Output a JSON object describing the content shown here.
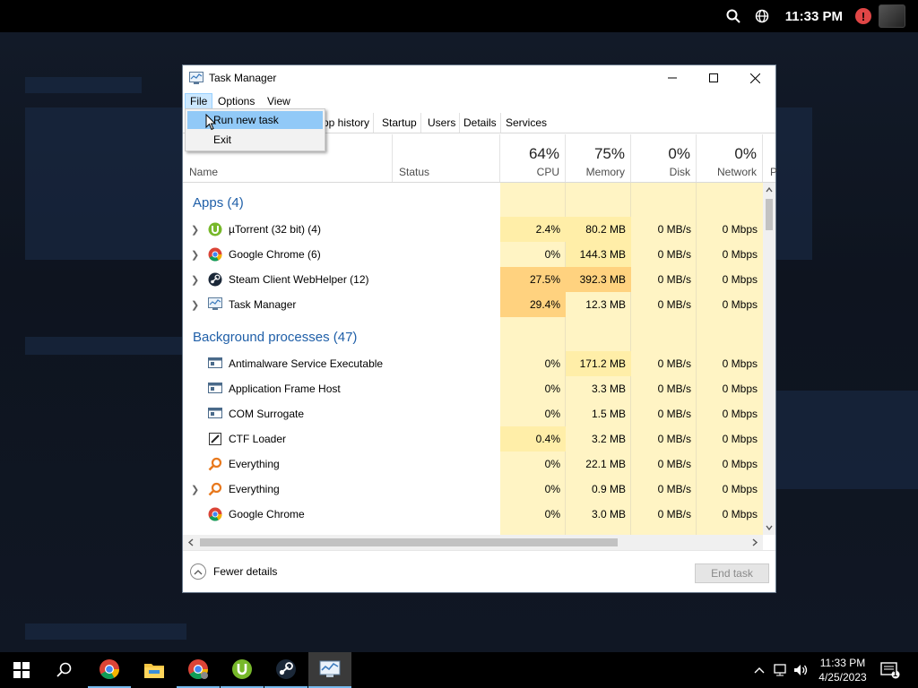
{
  "topbar": {
    "time": "11:33 PM",
    "alert": "!"
  },
  "window": {
    "title": "Task Manager",
    "menus": [
      "File",
      "Options",
      "View"
    ],
    "file_menu_items": [
      "Run new task",
      "Exit"
    ],
    "tabs": [
      "pp history",
      "Startup",
      "Users",
      "Details",
      "Services"
    ],
    "columns": {
      "name": "Name",
      "status": "Status",
      "cpu": {
        "pct": "64%",
        "label": "CPU"
      },
      "memory": {
        "pct": "75%",
        "label": "Memory"
      },
      "disk": {
        "pct": "0%",
        "label": "Disk"
      },
      "network": {
        "pct": "0%",
        "label": "Network"
      },
      "power": "P"
    },
    "groups": {
      "apps": "Apps (4)",
      "background": "Background processes (47)"
    },
    "apps": [
      {
        "name": "µTorrent (32 bit) (4)",
        "cpu": "2.4%",
        "memory": "80.2 MB",
        "disk": "0 MB/s",
        "network": "0 Mbps"
      },
      {
        "name": "Google Chrome (6)",
        "cpu": "0%",
        "memory": "144.3 MB",
        "disk": "0 MB/s",
        "network": "0 Mbps"
      },
      {
        "name": "Steam Client WebHelper (12)",
        "cpu": "27.5%",
        "memory": "392.3 MB",
        "disk": "0 MB/s",
        "network": "0 Mbps"
      },
      {
        "name": "Task Manager",
        "cpu": "29.4%",
        "memory": "12.3 MB",
        "disk": "0 MB/s",
        "network": "0 Mbps"
      }
    ],
    "background": [
      {
        "name": "Antimalware Service Executable",
        "cpu": "0%",
        "memory": "171.2 MB",
        "disk": "0 MB/s",
        "network": "0 Mbps"
      },
      {
        "name": "Application Frame Host",
        "cpu": "0%",
        "memory": "3.3 MB",
        "disk": "0 MB/s",
        "network": "0 Mbps"
      },
      {
        "name": "COM Surrogate",
        "cpu": "0%",
        "memory": "1.5 MB",
        "disk": "0 MB/s",
        "network": "0 Mbps"
      },
      {
        "name": "CTF Loader",
        "cpu": "0.4%",
        "memory": "3.2 MB",
        "disk": "0 MB/s",
        "network": "0 Mbps"
      },
      {
        "name": "Everything",
        "cpu": "0%",
        "memory": "22.1 MB",
        "disk": "0 MB/s",
        "network": "0 Mbps"
      },
      {
        "name": "Everything",
        "cpu": "0%",
        "memory": "0.9 MB",
        "disk": "0 MB/s",
        "network": "0 Mbps"
      },
      {
        "name": "Google Chrome",
        "cpu": "0%",
        "memory": "3.0 MB",
        "disk": "0 MB/s",
        "network": "0 Mbps"
      }
    ],
    "footer": {
      "fewer_details": "Fewer details",
      "end_task": "End task"
    }
  },
  "taskbar": {
    "time": "11:33 PM",
    "date": "4/25/2023",
    "notification_count": "1"
  },
  "colors": {
    "accent_blue": "#1f5fa8",
    "heat_low": "#fff4c4",
    "heat_mid": "#ffe9a0",
    "heat_high": "#ffd27f",
    "highlight": "#91c9f7"
  }
}
